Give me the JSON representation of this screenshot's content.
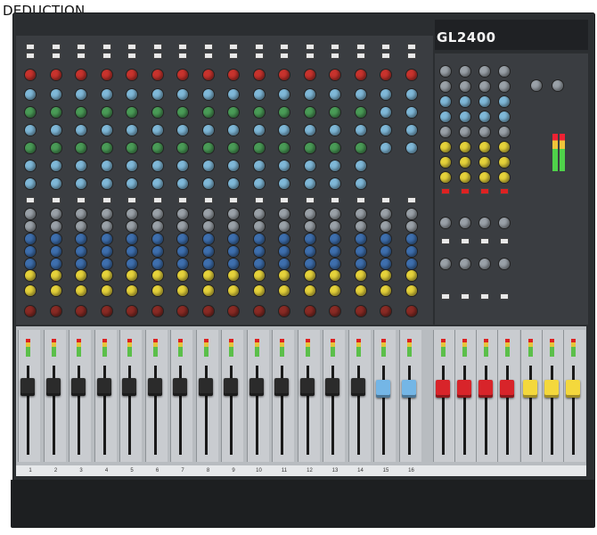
{
  "watermark": "DEDUCTION",
  "model": "GL2400",
  "mono_channel_count": 14,
  "stereo_channel_count": 2,
  "group_count": 4,
  "master_count": 3,
  "channel_numbers": [
    "1",
    "2",
    "3",
    "4",
    "5",
    "6",
    "7",
    "8",
    "9",
    "10",
    "11",
    "12",
    "13",
    "14",
    "15",
    "16"
  ],
  "colors": {
    "console_body": "#2b2e31",
    "panel": "#3a3d41",
    "fader_bay": "#c9ccd0",
    "knob_red": "#c8332d",
    "knob_cyan": "#7fb8d8",
    "knob_green": "#4a9b57",
    "knob_blue": "#3e6fae",
    "knob_yellow": "#e5d23b",
    "fader_cap_channel": "#2b2b2b",
    "fader_cap_stereo": "#74b6e6",
    "fader_cap_group": "#d8242a",
    "fader_cap_master": "#f4d83c"
  }
}
